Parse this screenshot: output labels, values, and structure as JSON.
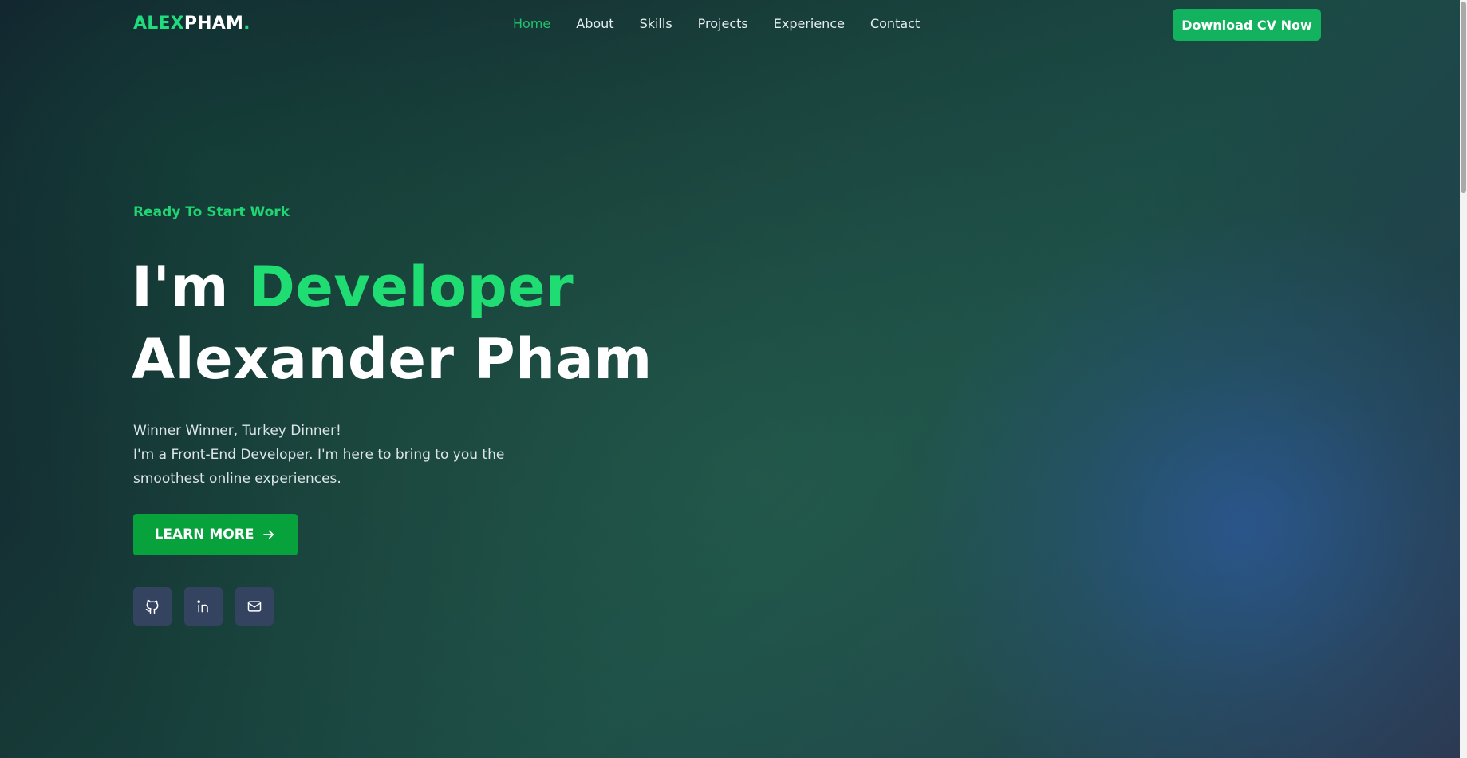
{
  "brand": {
    "logo_accent": "ALEX",
    "logo_main": "PHAM",
    "logo_dot": "."
  },
  "nav": {
    "items": [
      {
        "label": "Home",
        "active": true
      },
      {
        "label": "About"
      },
      {
        "label": "Skills"
      },
      {
        "label": "Projects"
      },
      {
        "label": "Experience"
      },
      {
        "label": "Contact"
      }
    ],
    "cv_button": "Download CV Now"
  },
  "hero": {
    "tagline": "Ready To Start Work",
    "heading_prefix": "I'm ",
    "heading_role": "Developer",
    "heading_name": "Alexander Pham",
    "desc_line1": "Winner Winner, Turkey Dinner!",
    "desc_line2": "I'm a Front-End Developer. I'm here to bring to you the smoothest online experiences.",
    "learn_more": "LEARN MORE"
  },
  "socials": [
    "github-icon",
    "linkedin-icon",
    "mail-icon"
  ],
  "colors": {
    "accent": "#1fdc73",
    "button_green": "#07a23c",
    "cv_button": "#12b25e",
    "nav_active": "#22c36e",
    "social_bg": "#344360"
  }
}
